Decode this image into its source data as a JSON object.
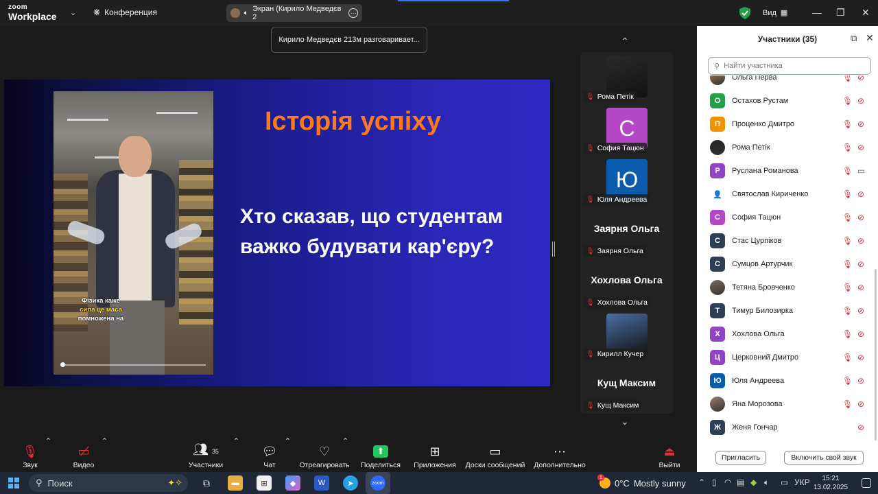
{
  "app": {
    "logo_top": "zoom",
    "logo_bottom": "Workplace",
    "meeting_label": "Конференция"
  },
  "share_pill": {
    "label": "Экран (Кирило Медведєв 2"
  },
  "view_label": "Вид",
  "toast": "Кирило Медведєв 213м разговаривает...",
  "slide": {
    "title": "Історія успіху",
    "question": "Хто сказав, що студентам важко будувати кар'єру?",
    "caption_line1": "Фізика каже",
    "caption_line2": "сила це маса",
    "caption_line3": "помножена на"
  },
  "tiles": [
    {
      "name": "Рома Петік",
      "kind": "photo",
      "color": "#2a2a2a"
    },
    {
      "name": "София Тацюн",
      "kind": "letter",
      "letter": "С",
      "color": "#b548c6"
    },
    {
      "name": "Юля Андреева",
      "kind": "letter",
      "letter": "Ю",
      "color": "#0b5cad"
    },
    {
      "name": "Заярня Ольга",
      "kind": "name",
      "big": "Заярня Ольга"
    },
    {
      "name": "Хохлова Ольга",
      "kind": "name",
      "big": "Хохлова Ольга"
    },
    {
      "name": "Кирилл Кучер",
      "kind": "photo",
      "color": "#4a6fa5"
    },
    {
      "name": "Кущ Максим",
      "kind": "name",
      "big": "Кущ Максим"
    }
  ],
  "panel": {
    "title": "Участники (35)",
    "search_placeholder": "Найти участника",
    "invite": "Пригласить",
    "unmute": "Включить свой звук"
  },
  "participants": [
    {
      "name": "Ольга Перва",
      "letter": "",
      "color": "#a67c52",
      "photo": true,
      "cam_on": false
    },
    {
      "name": "Остахов Рустам",
      "letter": "О",
      "color": "#22a04a",
      "photo": false,
      "cam_on": false
    },
    {
      "name": "Проценко Дмитро",
      "letter": "П",
      "color": "#f39200",
      "photo": false,
      "cam_on": false
    },
    {
      "name": "Рома Петік",
      "letter": "",
      "color": "#222222",
      "photo": true,
      "cam_on": false
    },
    {
      "name": "Руслана Романова",
      "letter": "Р",
      "color": "#8e44c4",
      "photo": false,
      "cam_on": true
    },
    {
      "name": "Святослав Кириченко",
      "letter": "👤",
      "color": "#ffffff",
      "photo": false,
      "cam_on": false,
      "icon": true
    },
    {
      "name": "София Тацюн",
      "letter": "С",
      "color": "#b548c6",
      "photo": false,
      "cam_on": false
    },
    {
      "name": "Стас Цурпіков",
      "letter": "С",
      "color": "#2d3e55",
      "photo": false,
      "cam_on": false
    },
    {
      "name": "Сумцов Артурчик",
      "letter": "С",
      "color": "#2d3e55",
      "photo": false,
      "cam_on": false
    },
    {
      "name": "Тетяна Бровченко",
      "letter": "",
      "color": "#7a6a5a",
      "photo": true,
      "cam_on": false
    },
    {
      "name": "Тимур Билозирка",
      "letter": "Т",
      "color": "#2d3e55",
      "photo": false,
      "cam_on": false
    },
    {
      "name": "Хохлова Ольга",
      "letter": "Х",
      "color": "#8e44c4",
      "photo": false,
      "cam_on": false
    },
    {
      "name": "Церковний Дмитро",
      "letter": "Ц",
      "color": "#8e44c4",
      "photo": false,
      "cam_on": false
    },
    {
      "name": "Юля Андреева",
      "letter": "Ю",
      "color": "#0b5cad",
      "photo": false,
      "cam_on": false
    },
    {
      "name": "Яна Морозова",
      "letter": "",
      "color": "#9a7a6a",
      "photo": true,
      "cam_on": false
    },
    {
      "name": "Женя Гончар",
      "letter": "Ж",
      "color": "#2d3e55",
      "photo": false,
      "cam_on": false,
      "no_mic": true
    }
  ],
  "toolbar": {
    "audio": "Звук",
    "video": "Видео",
    "participants": "Участники",
    "participants_count": "35",
    "chat": "Чат",
    "react": "Отреагировать",
    "share": "Поделиться",
    "apps": "Приложения",
    "whiteboards": "Доски сообщений",
    "more": "Дополнительно",
    "leave": "Выйти"
  },
  "taskbar": {
    "search": "Поиск",
    "weather_temp": "0°C",
    "weather_text": "Mostly sunny",
    "weather_badge": "1",
    "lang": "УКР",
    "time": "15:21",
    "date": "13.02.2025"
  },
  "colors": {
    "accent_orange": "#ff7a1a",
    "share_green": "#22c55e",
    "muted_red": "#e0303a"
  }
}
